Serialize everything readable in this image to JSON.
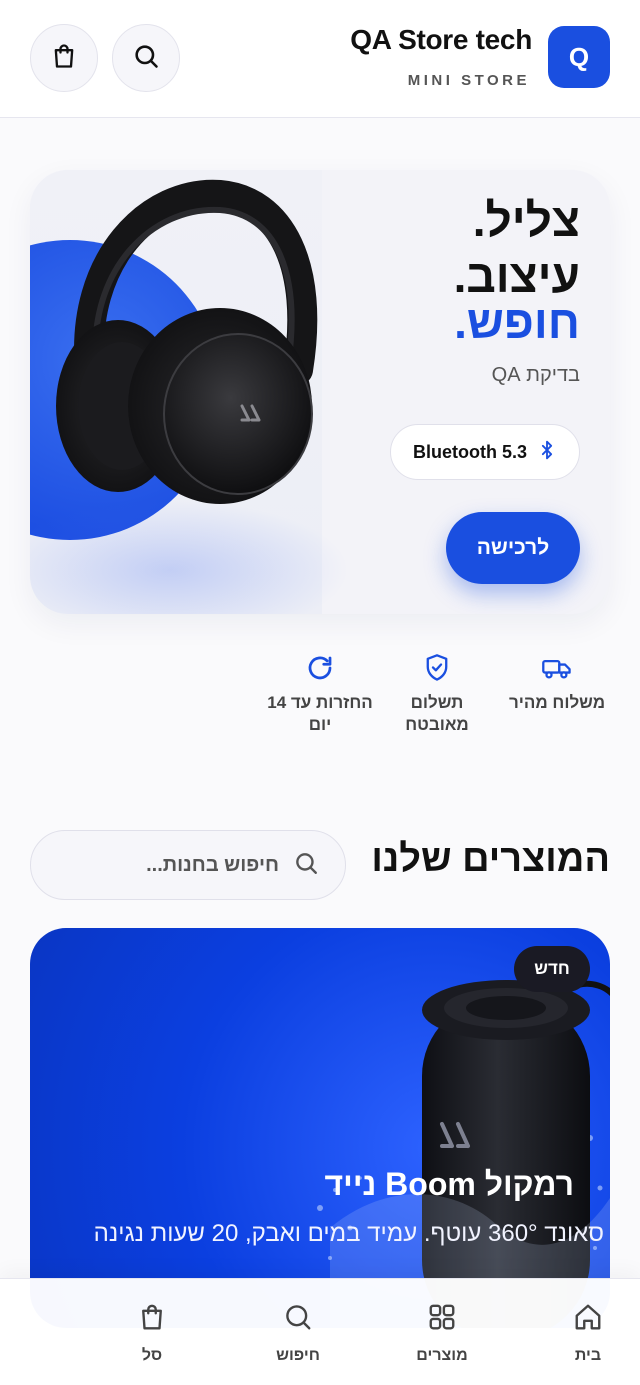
{
  "header": {
    "logo_letter": "Q",
    "brand_title": "QA Store tech",
    "brand_subtitle": "MINI STORE",
    "search_icon": "search-icon",
    "cart_icon": "shopping-bag-icon"
  },
  "hero": {
    "headline_line1": "צליל.",
    "headline_line2": "עיצוב.",
    "headline_line3": "חופש.",
    "subtitle": "בדיקת QA",
    "bluetooth_label": "Bluetooth 5.3",
    "buy_button": "לרכישה",
    "image": "headphones-image"
  },
  "features": [
    {
      "icon": "truck-icon",
      "label": "משלוח מהיר"
    },
    {
      "icon": "shield-check-icon",
      "label": "תשלום מאובטח"
    },
    {
      "icon": "refresh-icon",
      "label": "החזרות עד 14 יום"
    }
  ],
  "products": {
    "title": "המוצרים שלנו",
    "search_placeholder": "חיפוש בחנות..."
  },
  "product_card": {
    "badge": "חדש",
    "title": "רמקול Boom נייד",
    "description": "סאונד 360° עוטף. עמיד במים ואבק, 20 שעות נגינה",
    "image": "speaker-image"
  },
  "bottom_nav": [
    {
      "icon": "home-icon",
      "label": "בית"
    },
    {
      "icon": "grid-icon",
      "label": "מוצרים"
    },
    {
      "icon": "search-icon",
      "label": "חיפוש"
    },
    {
      "icon": "shopping-bag-icon",
      "label": "סל"
    }
  ],
  "colors": {
    "accent": "#1a4fe0",
    "dark": "#111111",
    "badge_bg": "#1a1a24"
  }
}
